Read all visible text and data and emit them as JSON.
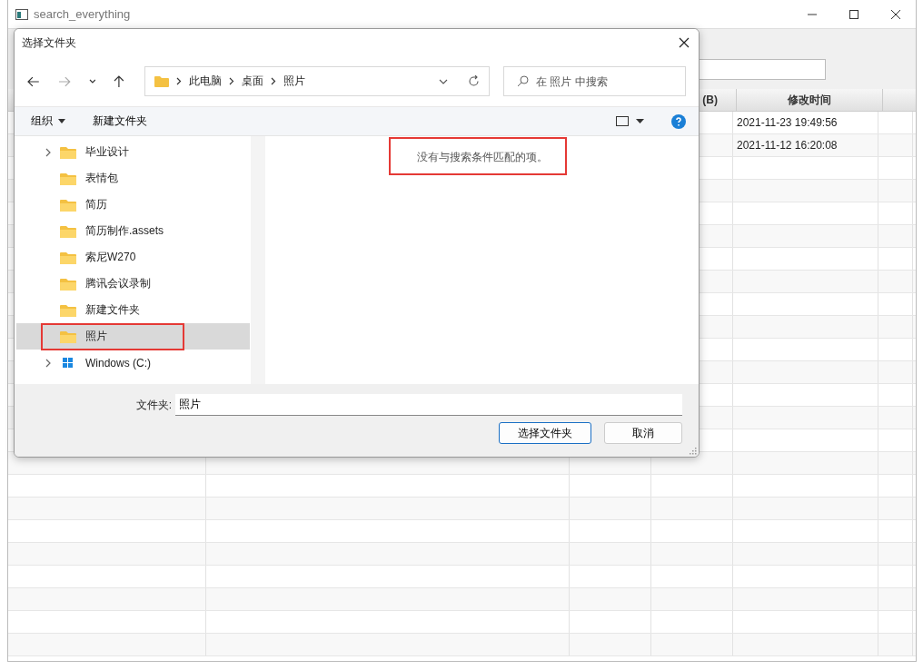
{
  "window": {
    "title": "search_everything"
  },
  "table": {
    "header": {
      "column_4": "(B)",
      "column_5": "修改时间"
    },
    "rows": [
      {
        "column_5": "2021-11-23 19:49:56"
      },
      {
        "column_5": "2021-11-12 16:20:08"
      }
    ]
  },
  "dialog": {
    "title": "选择文件夹",
    "breadcrumb": [
      "此电脑",
      "桌面",
      "照片"
    ],
    "search": {
      "placeholder": "在 照片 中搜索"
    },
    "toolbar": {
      "organize": "组织",
      "new_folder": "新建文件夹"
    },
    "tree": [
      {
        "label": "毕业设计",
        "expandable": true,
        "selected": false,
        "kind": "folder"
      },
      {
        "label": "表情包",
        "expandable": false,
        "selected": false,
        "kind": "folder"
      },
      {
        "label": "简历",
        "expandable": false,
        "selected": false,
        "kind": "folder"
      },
      {
        "label": "简历制作.assets",
        "expandable": false,
        "selected": false,
        "kind": "folder"
      },
      {
        "label": "索尼W270",
        "expandable": false,
        "selected": false,
        "kind": "folder"
      },
      {
        "label": "腾讯会议录制",
        "expandable": false,
        "selected": false,
        "kind": "folder"
      },
      {
        "label": "新建文件夹",
        "expandable": false,
        "selected": false,
        "kind": "folder"
      },
      {
        "label": "照片",
        "expandable": false,
        "selected": true,
        "kind": "folder"
      },
      {
        "label": "Windows (C:)",
        "expandable": true,
        "selected": false,
        "kind": "drive"
      }
    ],
    "empty_message": "没有与搜索条件匹配的项。",
    "folder_label": "文件夹:",
    "folder_value": "照片",
    "buttons": [
      {
        "label": "选择文件夹",
        "default": true
      },
      {
        "label": "取消",
        "default": false
      }
    ]
  }
}
